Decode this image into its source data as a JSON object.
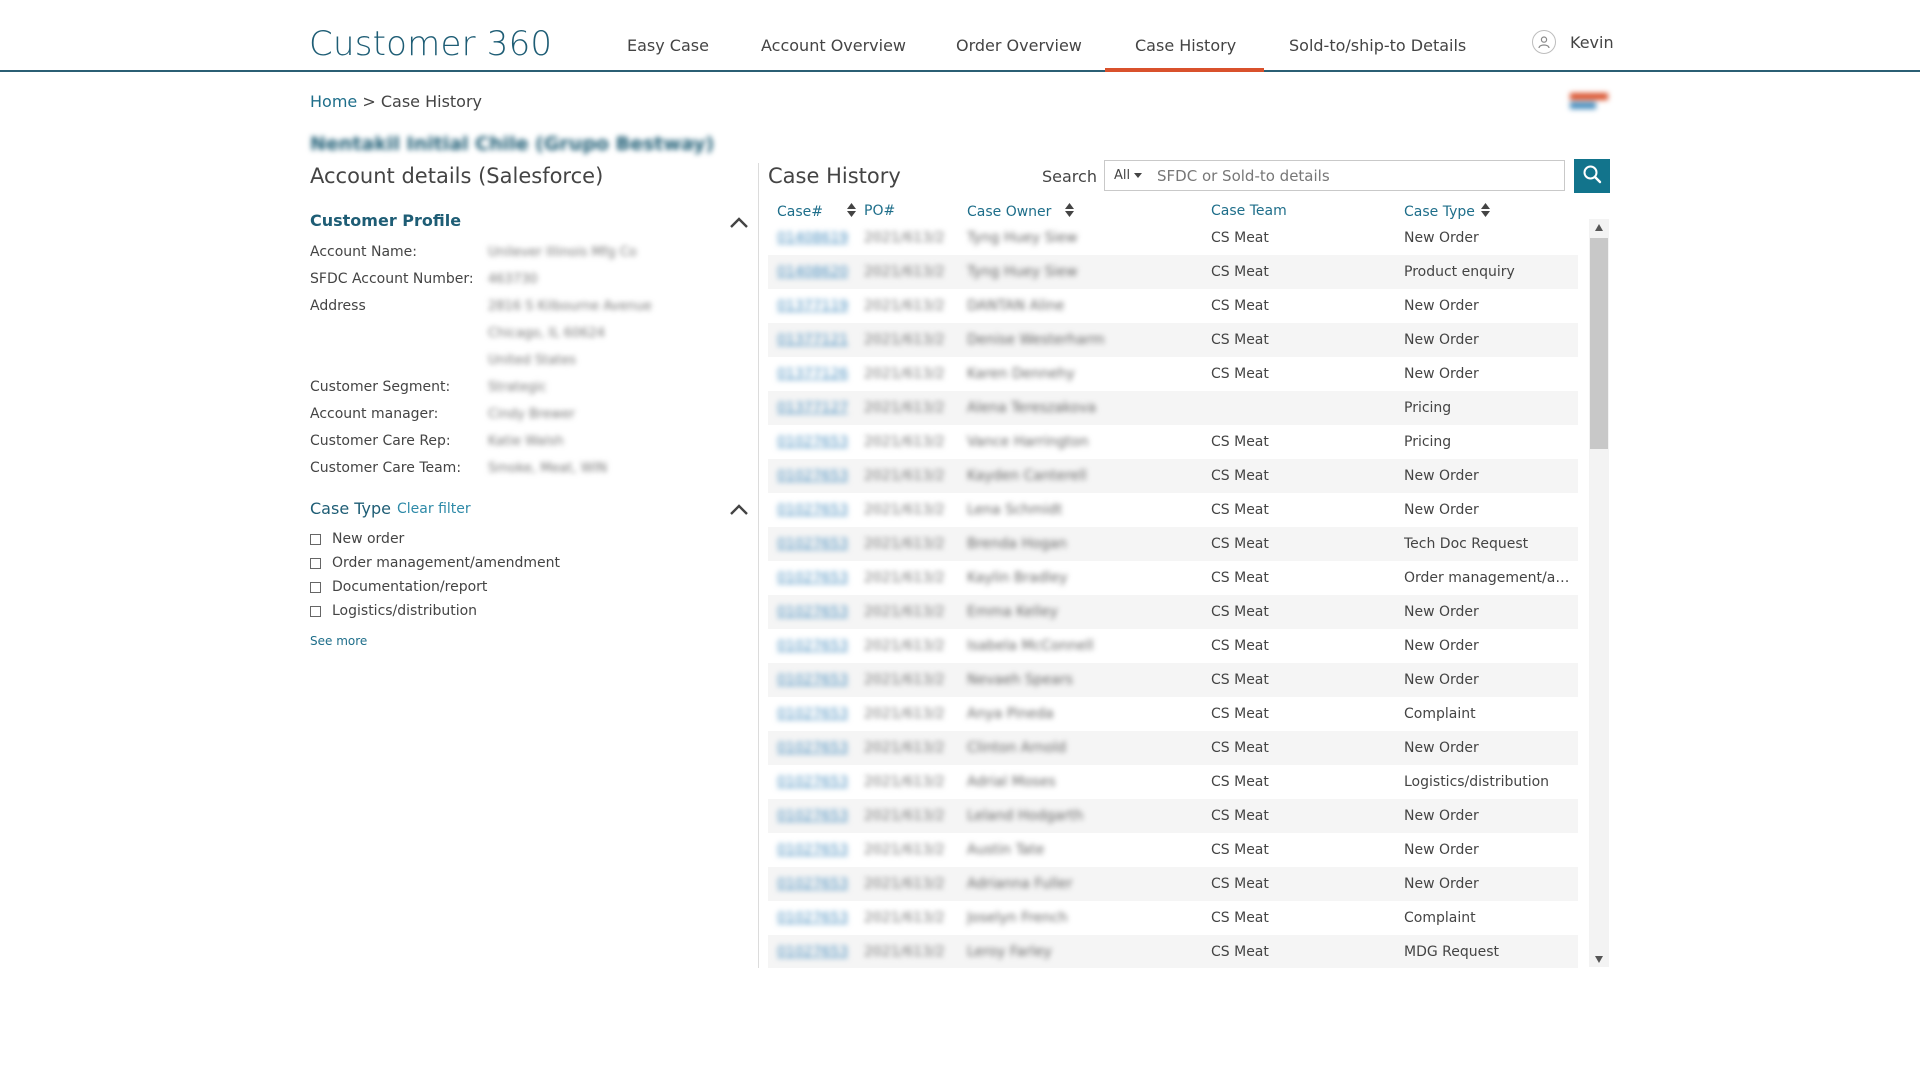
{
  "app": {
    "title": "Customer 360"
  },
  "nav": {
    "items": [
      {
        "label": "Easy Case"
      },
      {
        "label": "Account Overview"
      },
      {
        "label": "Order Overview"
      },
      {
        "label": "Case History"
      },
      {
        "label": "Sold-to/ship-to Details"
      }
    ],
    "active": "Case History"
  },
  "user": {
    "name": "Kevin",
    "icon": "user-icon"
  },
  "breadcrumb": {
    "home": "Home",
    "separator": ">",
    "current": "Case History"
  },
  "account": {
    "name": "Nentakil Initial Chile (Grupo Bestway)",
    "section_title": "Account details (Salesforce)"
  },
  "profile": {
    "title": "Customer Profile",
    "fields": [
      {
        "label": "Account Name:",
        "value": "Unilever Illinois Mfg Co"
      },
      {
        "label": "SFDC Account Number:",
        "value": "463730"
      },
      {
        "label": "Address",
        "value": "2816 S Kilbourne Avenue"
      },
      {
        "label": "",
        "value": "Chicago, IL 60624"
      },
      {
        "label": "",
        "value": "United States"
      },
      {
        "label": "Customer Segment:",
        "value": "Strategic"
      },
      {
        "label": "Account manager:",
        "value": "Cindy Brewer"
      },
      {
        "label": "Customer Care Rep:",
        "value": "Katie Walsh"
      },
      {
        "label": "Customer Care Team:",
        "value": "Smoke, Meat, WIN"
      }
    ]
  },
  "case_type_filter": {
    "title": "Case Type",
    "clear_label": "Clear filter",
    "options": [
      "New order",
      "Order management/amendment",
      "Documentation/report",
      "Logistics/distribution"
    ],
    "see_more": "See more"
  },
  "case_history": {
    "title": "Case History",
    "search": {
      "label": "Search",
      "scope": "All",
      "placeholder": "SFDC or Sold-to details"
    },
    "columns": [
      "Case#",
      "PO#",
      "Case Owner",
      "Case Team",
      "Case Type"
    ],
    "rows": [
      {
        "case": "01408619",
        "po": "2021/613/2",
        "owner": "Tyng Huey Siew",
        "team": "CS Meat",
        "type": "New Order"
      },
      {
        "case": "01408620",
        "po": "2021/613/2",
        "owner": "Tyng Huey Siew",
        "team": "CS Meat",
        "type": "Product enquiry"
      },
      {
        "case": "01377119",
        "po": "2021/613/2",
        "owner": "DANTAN Aline",
        "team": "CS Meat",
        "type": "New Order"
      },
      {
        "case": "01377121",
        "po": "2021/613/2",
        "owner": "Denise Westerharm",
        "team": "CS Meat",
        "type": "New Order"
      },
      {
        "case": "01377126",
        "po": "2021/613/2",
        "owner": "Karen Dennehy",
        "team": "CS Meat",
        "type": "New Order"
      },
      {
        "case": "01377127",
        "po": "2021/613/2",
        "owner": "Alena Tereszakova",
        "team": "",
        "type": "Pricing"
      },
      {
        "case": "01027653",
        "po": "2021/613/2",
        "owner": "Vance Harrington",
        "team": "CS Meat",
        "type": "Pricing"
      },
      {
        "case": "01027653",
        "po": "2021/613/2",
        "owner": "Kayden Canterell",
        "team": "CS Meat",
        "type": "New Order"
      },
      {
        "case": "01027653",
        "po": "2021/613/2",
        "owner": "Lena Schmidt",
        "team": "CS Meat",
        "type": "New Order"
      },
      {
        "case": "01027653",
        "po": "2021/613/2",
        "owner": "Brenda Hogan",
        "team": "CS Meat",
        "type": "Tech Doc Request"
      },
      {
        "case": "01027653",
        "po": "2021/613/2",
        "owner": "Kaylin Bradley",
        "team": "CS Meat",
        "type": "Order management/amendment"
      },
      {
        "case": "01027653",
        "po": "2021/613/2",
        "owner": "Emma Kelley",
        "team": "CS Meat",
        "type": "New Order"
      },
      {
        "case": "01027653",
        "po": "2021/613/2",
        "owner": "Isabela McConnell",
        "team": "CS Meat",
        "type": "New Order"
      },
      {
        "case": "01027653",
        "po": "2021/613/2",
        "owner": "Nevaeh Spears",
        "team": "CS Meat",
        "type": "New Order"
      },
      {
        "case": "01027653",
        "po": "2021/613/2",
        "owner": "Anya Pineda",
        "team": "CS Meat",
        "type": "Complaint"
      },
      {
        "case": "01027653",
        "po": "2021/613/2",
        "owner": "Clinton Arnold",
        "team": "CS Meat",
        "type": "New Order"
      },
      {
        "case": "01027653",
        "po": "2021/613/2",
        "owner": "Adrial Moses",
        "team": "CS Meat",
        "type": "Logistics/distribution"
      },
      {
        "case": "01027653",
        "po": "2021/613/2",
        "owner": "Leland Hodgarth",
        "team": "CS Meat",
        "type": "New Order"
      },
      {
        "case": "01027653",
        "po": "2021/613/2",
        "owner": "Austin Tate",
        "team": "CS Meat",
        "type": "New Order"
      },
      {
        "case": "01027653",
        "po": "2021/613/2",
        "owner": "Adrianna Fuller",
        "team": "CS Meat",
        "type": "New Order"
      },
      {
        "case": "01027653",
        "po": "2021/613/2",
        "owner": "Joselyn French",
        "team": "CS Meat",
        "type": "Complaint"
      },
      {
        "case": "01027653",
        "po": "2021/613/2",
        "owner": "Leroy Farley",
        "team": "CS Meat",
        "type": "MDG Request"
      }
    ]
  },
  "colors": {
    "brand": "#1e5d75",
    "accent": "#d9512c",
    "link": "#1e6e8a",
    "search_button": "#12748c"
  }
}
